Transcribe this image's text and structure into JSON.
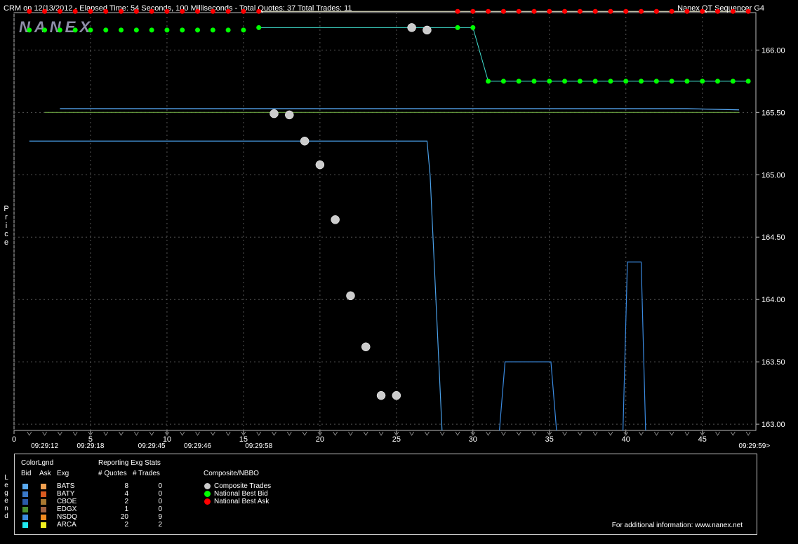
{
  "header": {
    "title": "CRM on 12/13/2012  -  Elapsed Time: 54 Seconds, 100 Milliseconds  -  Total Quotes: 37  Total Trades: 11",
    "app": "Nanex QT Sequencer G4",
    "logo": "NANEX"
  },
  "chart_data": {
    "type": "scatter",
    "ylabel": "Price",
    "ylim": [
      162.95,
      166.3
    ],
    "xlim": [
      0,
      48.5
    ],
    "y_ticks": [
      "166.00",
      "165.50",
      "165.00",
      "164.50",
      "164.00",
      "163.50",
      "163.00"
    ],
    "y_tick_values": [
      166.0,
      165.5,
      165.0,
      164.5,
      164.0,
      163.5,
      163.0
    ],
    "x_ticks": [
      "0",
      "5",
      "10",
      "15",
      "20",
      "25",
      "30",
      "35",
      "40",
      "45"
    ],
    "x_tick_values": [
      0,
      5,
      10,
      15,
      20,
      25,
      30,
      35,
      40,
      45
    ],
    "time_labels": [
      {
        "x": 2,
        "label": "09:29:12"
      },
      {
        "x": 5,
        "label": "09:29:18"
      },
      {
        "x": 9,
        "label": "09:29:45"
      },
      {
        "x": 12,
        "label": "09:29:46"
      },
      {
        "x": 16,
        "label": "09:29:58"
      },
      {
        "x": 48.4,
        "label": "09:29:59>"
      }
    ],
    "series": [
      {
        "name": "National Best Ask",
        "color": "#ff0000",
        "marker": "dot",
        "points": [
          [
            1,
            166.31
          ],
          [
            2,
            166.31
          ],
          [
            3,
            166.31
          ],
          [
            4,
            166.31
          ],
          [
            5,
            166.31
          ],
          [
            6,
            166.31
          ],
          [
            7,
            166.31
          ],
          [
            8,
            166.31
          ],
          [
            9,
            166.31
          ],
          [
            10,
            166.31
          ],
          [
            11,
            166.31
          ],
          [
            12,
            166.31
          ],
          [
            13,
            166.31
          ],
          [
            14,
            166.31
          ],
          [
            15,
            166.31
          ],
          [
            16,
            166.31
          ],
          [
            29,
            166.31
          ],
          [
            30,
            166.31
          ],
          [
            31,
            166.31
          ],
          [
            32,
            166.31
          ],
          [
            33,
            166.31
          ],
          [
            34,
            166.31
          ],
          [
            35,
            166.31
          ],
          [
            36,
            166.31
          ],
          [
            37,
            166.31
          ],
          [
            38,
            166.31
          ],
          [
            39,
            166.31
          ],
          [
            40,
            166.31
          ],
          [
            41,
            166.31
          ],
          [
            42,
            166.31
          ],
          [
            43,
            166.31
          ],
          [
            44,
            166.31
          ],
          [
            45,
            166.31
          ],
          [
            46,
            166.31
          ],
          [
            47,
            166.31
          ],
          [
            48,
            166.31
          ]
        ],
        "line_from": 16
      },
      {
        "name": "National Best Bid",
        "color": "#00ff00",
        "marker": "dot",
        "points": [
          [
            1,
            166.16
          ],
          [
            2,
            166.16
          ],
          [
            3,
            166.16
          ],
          [
            4,
            166.16
          ],
          [
            5,
            166.16
          ],
          [
            6,
            166.16
          ],
          [
            7,
            166.16
          ],
          [
            8,
            166.16
          ],
          [
            9,
            166.16
          ],
          [
            10,
            166.16
          ],
          [
            11,
            166.16
          ],
          [
            12,
            166.16
          ],
          [
            13,
            166.16
          ],
          [
            14,
            166.16
          ],
          [
            15,
            166.16
          ],
          [
            16,
            166.18
          ],
          [
            29,
            166.18
          ],
          [
            30,
            166.18
          ],
          [
            31,
            165.75
          ],
          [
            32,
            165.75
          ],
          [
            33,
            165.75
          ],
          [
            34,
            165.75
          ],
          [
            35,
            165.75
          ],
          [
            36,
            165.75
          ],
          [
            37,
            165.75
          ],
          [
            38,
            165.75
          ],
          [
            39,
            165.75
          ],
          [
            40,
            165.75
          ],
          [
            41,
            165.75
          ],
          [
            42,
            165.75
          ],
          [
            43,
            165.75
          ],
          [
            44,
            165.75
          ],
          [
            45,
            165.75
          ],
          [
            46,
            165.75
          ],
          [
            47,
            165.75
          ],
          [
            48,
            165.75
          ]
        ],
        "line_from": 16
      },
      {
        "name": "Composite Trades",
        "color": "#cccccc",
        "marker": "circle",
        "points": [
          [
            17,
            165.49
          ],
          [
            18,
            165.48
          ],
          [
            19,
            165.27
          ],
          [
            20,
            165.08
          ],
          [
            21,
            164.64
          ],
          [
            22,
            164.03
          ],
          [
            23,
            163.62
          ],
          [
            24,
            163.23
          ],
          [
            25,
            163.23
          ],
          [
            26,
            166.18
          ],
          [
            27,
            166.16
          ]
        ]
      }
    ],
    "quote_lines": [
      {
        "exchange": "BATS-bid",
        "color": "#4aa0e8",
        "points": [
          [
            1,
            165.27
          ],
          [
            27.0,
            165.27
          ],
          [
            27.2,
            165.0
          ],
          [
            28.0,
            162.9
          ]
        ]
      },
      {
        "exchange": "NSDQ-bid-a",
        "color": "#3a8ae0",
        "points": [
          [
            31.7,
            162.9
          ],
          [
            32.1,
            163.5
          ],
          [
            35.1,
            163.5
          ],
          [
            35.5,
            162.9
          ]
        ]
      },
      {
        "exchange": "NSDQ-bid-b",
        "color": "#3a8ae0",
        "points": [
          [
            39.8,
            162.9
          ],
          [
            40.1,
            164.3
          ],
          [
            41.0,
            164.3
          ],
          [
            41.3,
            162.9
          ]
        ]
      },
      {
        "exchange": "ARCA-ask",
        "color": "#5ab0ff",
        "points": [
          [
            3,
            165.53
          ],
          [
            44,
            165.53
          ],
          [
            47.4,
            165.52
          ]
        ]
      },
      {
        "exchange": "EDGX-bid",
        "color": "#6aa040",
        "points": [
          [
            2,
            165.5
          ],
          [
            47.4,
            165.5
          ]
        ]
      }
    ]
  },
  "legend": {
    "side_label": "Legend",
    "headers": {
      "color": "ColorLgnd",
      "bid": "Bid",
      "ask": "Ask",
      "exg": "Exg",
      "stats": "Reporting Exg Stats",
      "quotes": "# Quotes",
      "trades": "# Trades",
      "composite": "Composite/NBBO"
    },
    "rows": [
      {
        "exg": "BATS",
        "quotes": "8",
        "trades": "0",
        "bid_color": "#5aaaf0",
        "ask_color": "#f0a050"
      },
      {
        "exg": "BATY",
        "quotes": "4",
        "trades": "0",
        "bid_color": "#3a78c8",
        "ask_color": "#d85a20"
      },
      {
        "exg": "CBOE",
        "quotes": "2",
        "trades": "0",
        "bid_color": "#2a58a8",
        "ask_color": "#a87830"
      },
      {
        "exg": "EDGX",
        "quotes": "1",
        "trades": "0",
        "bid_color": "#4a9030",
        "ask_color": "#a06040"
      },
      {
        "exg": "NSDQ",
        "quotes": "20",
        "trades": "9",
        "bid_color": "#3a8ae0",
        "ask_color": "#f08a20"
      },
      {
        "exg": "ARCA",
        "quotes": "2",
        "trades": "2",
        "bid_color": "#20e8f0",
        "ask_color": "#f0f020"
      }
    ],
    "composite": [
      {
        "label": "Composite Trades",
        "color": "#cccccc"
      },
      {
        "label": "National Best Bid",
        "color": "#00ff00"
      },
      {
        "label": "National Best Ask",
        "color": "#ff0000"
      }
    ],
    "url_text": "For additional information: www.nanex.net"
  }
}
